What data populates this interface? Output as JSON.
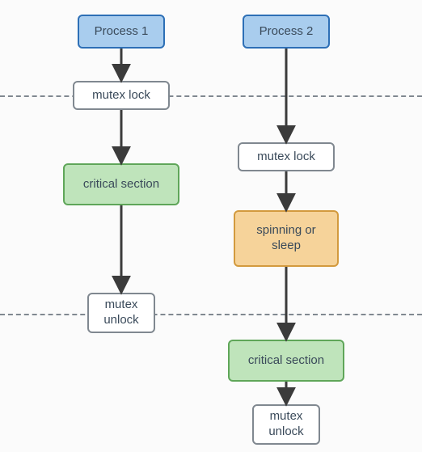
{
  "nodes": {
    "p1": {
      "label": "Process 1"
    },
    "p2": {
      "label": "Process 2"
    },
    "lock1": {
      "label": "mutex lock"
    },
    "lock2": {
      "label": "mutex lock"
    },
    "crit1": {
      "label": "critical section"
    },
    "crit2": {
      "label": "critical section"
    },
    "spin": {
      "label": "spinning or\nsleep"
    },
    "unlock1": {
      "label": "mutex\nunlock"
    },
    "unlock2": {
      "label": "mutex\nunlock"
    }
  },
  "chart_data": {
    "type": "diagram",
    "title": "",
    "description": "Two processes contending for a mutex. Process 1 acquires the lock, enters its critical section, then unlocks. Process 2 attempts to lock while Process 1 holds it, spins or sleeps until the lock is released, then enters its critical section and unlocks.",
    "lanes": [
      {
        "name": "Process 1",
        "steps": [
          "Process 1",
          "mutex lock",
          "critical section",
          "mutex unlock"
        ]
      },
      {
        "name": "Process 2",
        "steps": [
          "Process 2",
          "mutex lock",
          "spinning or sleep",
          "critical section",
          "mutex unlock"
        ]
      }
    ],
    "sync_lines": [
      "lock-acquire boundary (dashed line 1)",
      "lock-release boundary (dashed line 2)"
    ]
  }
}
